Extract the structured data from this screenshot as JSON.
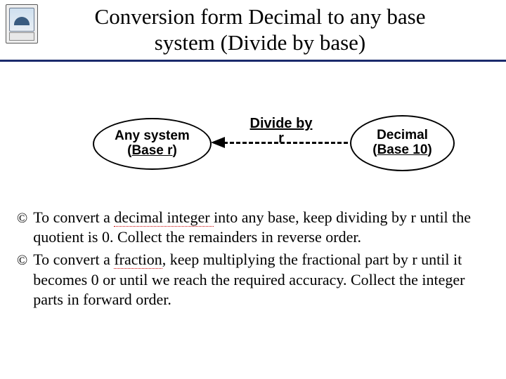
{
  "header": {
    "title_line1": "Conversion form Decimal to any base",
    "title_line2": "system (Divide by base)"
  },
  "diagram": {
    "left_oval_line1": "Any system",
    "left_oval_line2_pre": "(",
    "left_oval_line2_mid": "Base r",
    "left_oval_line2_post": ")",
    "arrow_label_line1": "Divide by",
    "arrow_label_line2": "r",
    "right_oval_line1": "Decimal",
    "right_oval_line2_pre": "(",
    "right_oval_line2_mid": "Base 10",
    "right_oval_line2_post": ")"
  },
  "bullets": {
    "b1_pre": "To convert a ",
    "b1_key": "decimal integer ",
    "b1_post": "into any base, keep dividing by r until the quotient is 0. Collect the remainders in reverse order.",
    "b2_pre": "To convert a ",
    "b2_key": "fraction",
    "b2_post": ", keep multiplying the fractional part by r until it becomes 0 or until we reach the required accuracy. Collect the integer parts in forward order."
  },
  "glyphs": {
    "copyright": "©"
  }
}
